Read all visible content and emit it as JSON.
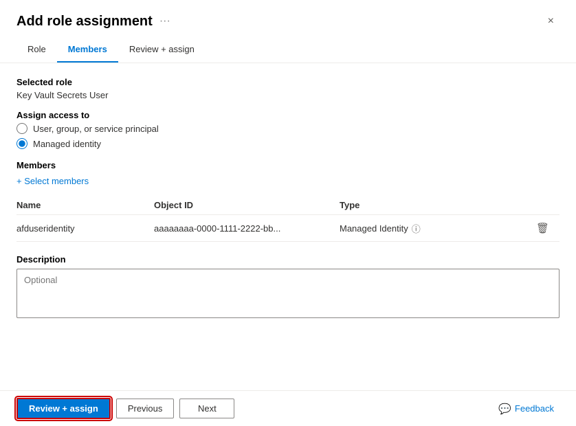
{
  "header": {
    "title": "Add role assignment",
    "ellipsis": "···",
    "close_label": "×"
  },
  "tabs": [
    {
      "id": "role",
      "label": "Role",
      "active": false
    },
    {
      "id": "members",
      "label": "Members",
      "active": true
    },
    {
      "id": "review",
      "label": "Review + assign",
      "active": false
    }
  ],
  "form": {
    "selected_role_label": "Selected role",
    "selected_role_value": "Key Vault Secrets User",
    "assign_access_label": "Assign access to",
    "radio_options": [
      {
        "id": "user_group",
        "label": "User, group, or service principal",
        "checked": false
      },
      {
        "id": "managed_identity",
        "label": "Managed identity",
        "checked": true
      }
    ],
    "members_label": "Members",
    "select_members_link": "+ Select members",
    "table": {
      "columns": [
        "Name",
        "Object ID",
        "Type"
      ],
      "rows": [
        {
          "name": "afduseridentity",
          "object_id": "aaaaaaaa-0000-1111-2222-bb...",
          "type": "Managed Identity"
        }
      ]
    },
    "description_label": "Description",
    "description_placeholder": "Optional"
  },
  "footer": {
    "review_assign_label": "Review + assign",
    "previous_label": "Previous",
    "next_label": "Next",
    "feedback_label": "Feedback"
  }
}
